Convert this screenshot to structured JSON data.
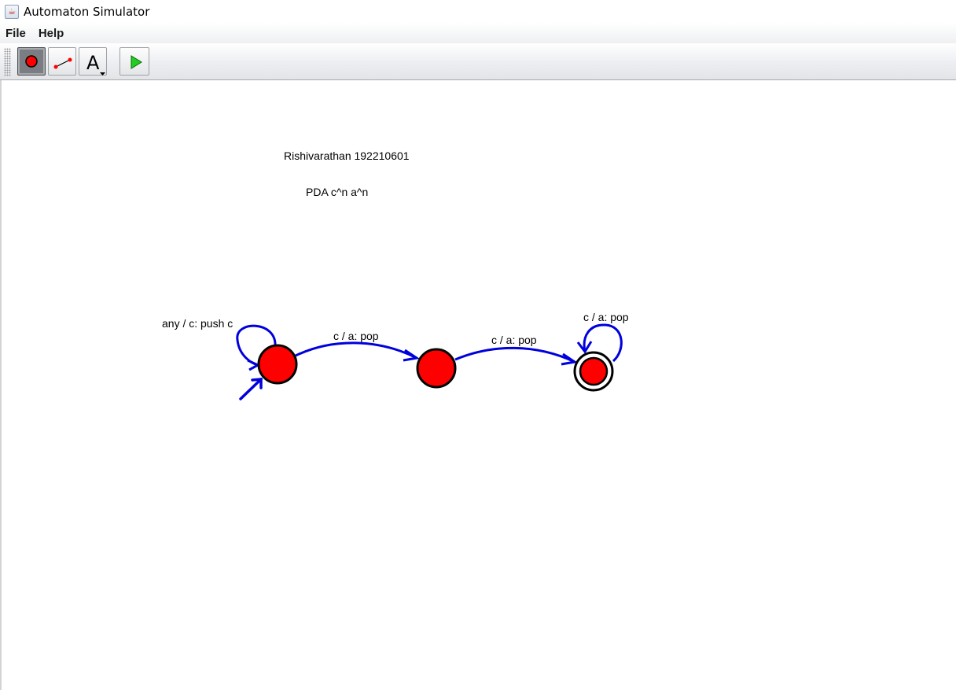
{
  "window": {
    "title": "Automaton Simulator",
    "icon": "java-cup-icon"
  },
  "menu": {
    "file": "File",
    "help": "Help"
  },
  "toolbar": {
    "tools": [
      {
        "name": "state-tool",
        "icon": "red-circle-icon",
        "selected": true
      },
      {
        "name": "transition-tool",
        "icon": "line-arrow-icon",
        "selected": false
      },
      {
        "name": "text-tool",
        "icon": "letter-a-dropdown-icon",
        "glyph": "A",
        "selected": false
      },
      {
        "name": "run-tool",
        "icon": "green-play-icon",
        "selected": false
      }
    ]
  },
  "canvas": {
    "annotations": {
      "author": "Rishivarathan 192210601",
      "subject": "PDA c^n a^n"
    },
    "states": [
      {
        "id": "q0",
        "initial": true,
        "accepting": false
      },
      {
        "id": "q1",
        "initial": false,
        "accepting": false
      },
      {
        "id": "q2",
        "initial": false,
        "accepting": true
      }
    ],
    "transitions": [
      {
        "from": "q0",
        "to": "q0",
        "label": "any / c: push c"
      },
      {
        "from": "q0",
        "to": "q1",
        "label": "c / a: pop"
      },
      {
        "from": "q1",
        "to": "q2",
        "label": "c / a: pop"
      },
      {
        "from": "q2",
        "to": "q2",
        "label": "c / a: pop"
      }
    ],
    "colors": {
      "state_fill": "#ff0000",
      "state_stroke": "#000000",
      "transition": "#0000dd"
    }
  }
}
